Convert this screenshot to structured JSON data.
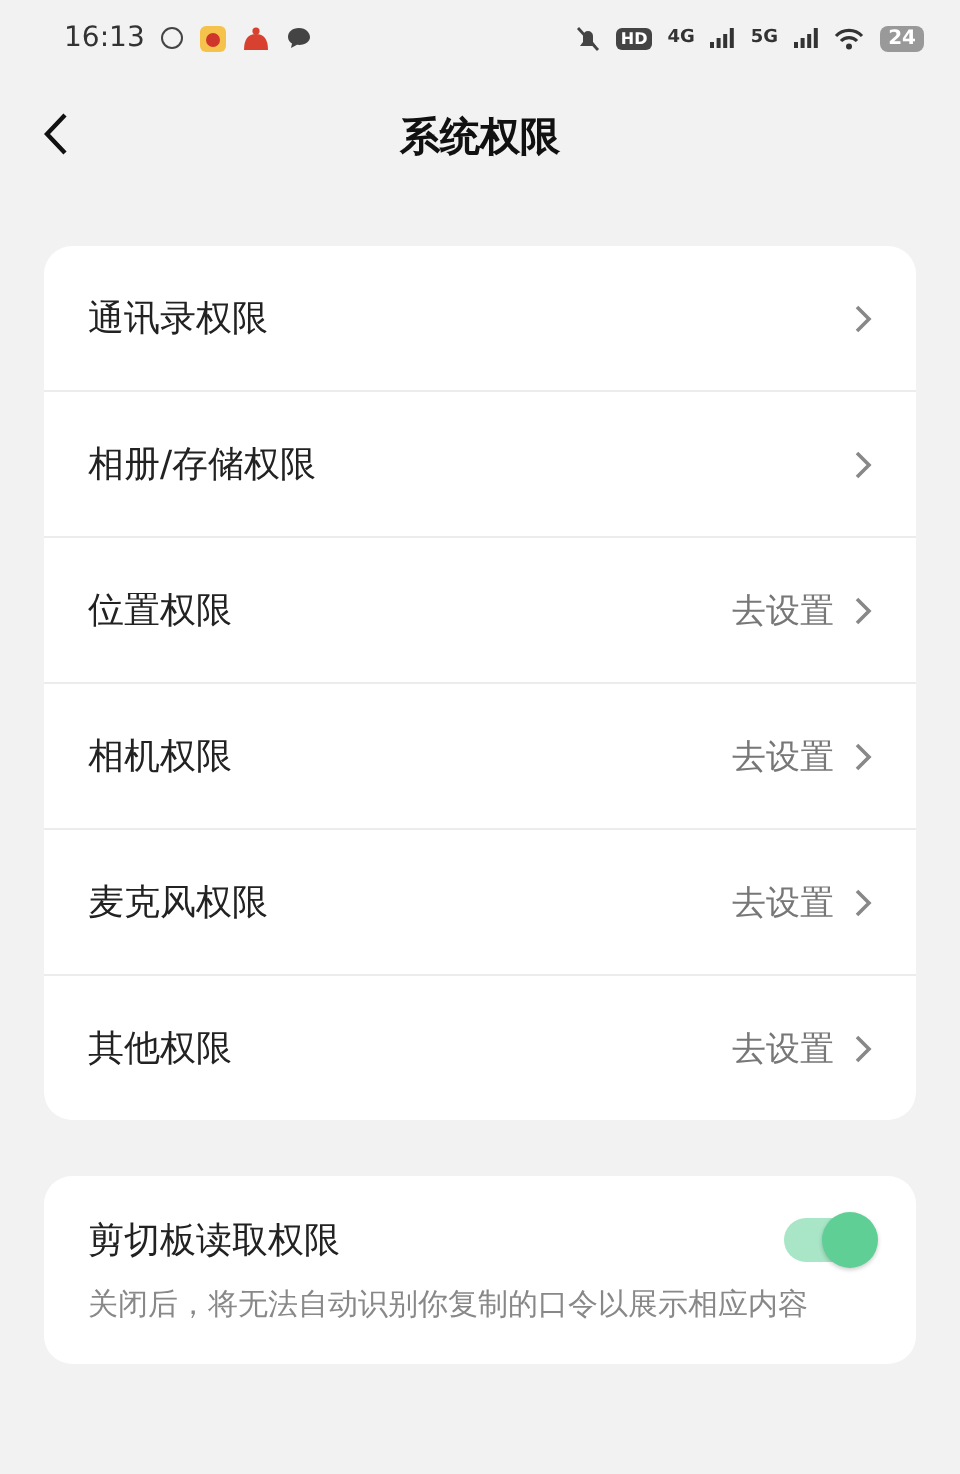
{
  "status_bar": {
    "time": "16:13",
    "hd": "HD",
    "networks": [
      "4G",
      "5G"
    ],
    "battery": "24"
  },
  "header": {
    "title": "系统权限"
  },
  "permissions": [
    {
      "label": "通讯录权限"
    },
    {
      "label": "相册/存储权限"
    },
    {
      "label": "位置权限",
      "action": "去设置"
    },
    {
      "label": "相机权限",
      "action": "去设置"
    },
    {
      "label": "麦克风权限",
      "action": "去设置"
    },
    {
      "label": "其他权限",
      "action": "去设置"
    }
  ],
  "clipboard": {
    "label": "剪切板读取权限",
    "on": true,
    "description": "关闭后，将无法自动识别你复制的口令以展示相应内容"
  }
}
